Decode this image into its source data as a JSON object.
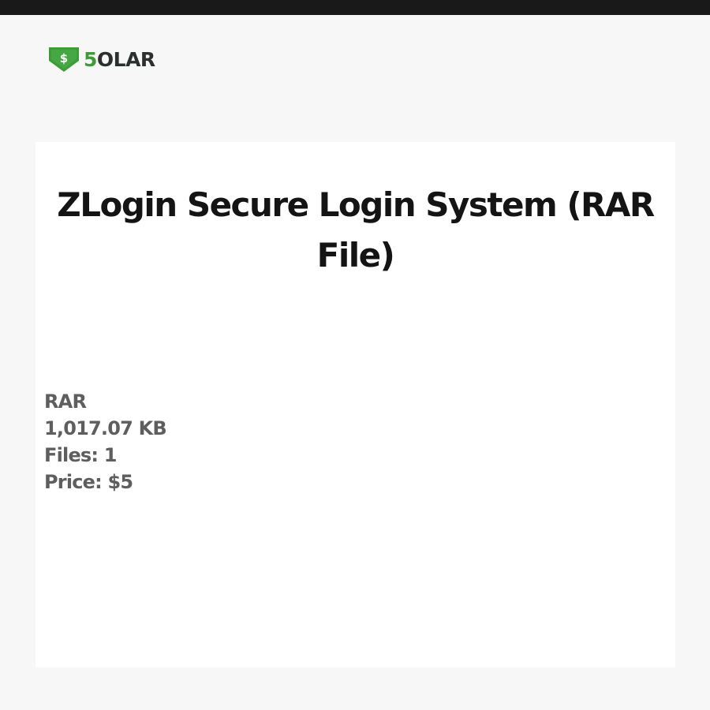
{
  "brand": {
    "logo_icon": "dollar-tag-arrow-icon",
    "logo_icon_symbol": "$",
    "logo_five": "5",
    "logo_word": "OLAR",
    "green": "#3d9b3a",
    "dark": "#2b2f2e"
  },
  "product": {
    "title": "ZLogin Secure Login System (RAR File)",
    "details": {
      "format": "RAR",
      "size": "1,017.07 KB",
      "files": "Files: 1",
      "price": "Price: $5"
    }
  },
  "colors": {
    "top_bar": "#191919",
    "page_background": "#f7f7f7",
    "card_background": "#ffffff",
    "title_text": "#141414",
    "details_text": "#5e5e5e"
  }
}
